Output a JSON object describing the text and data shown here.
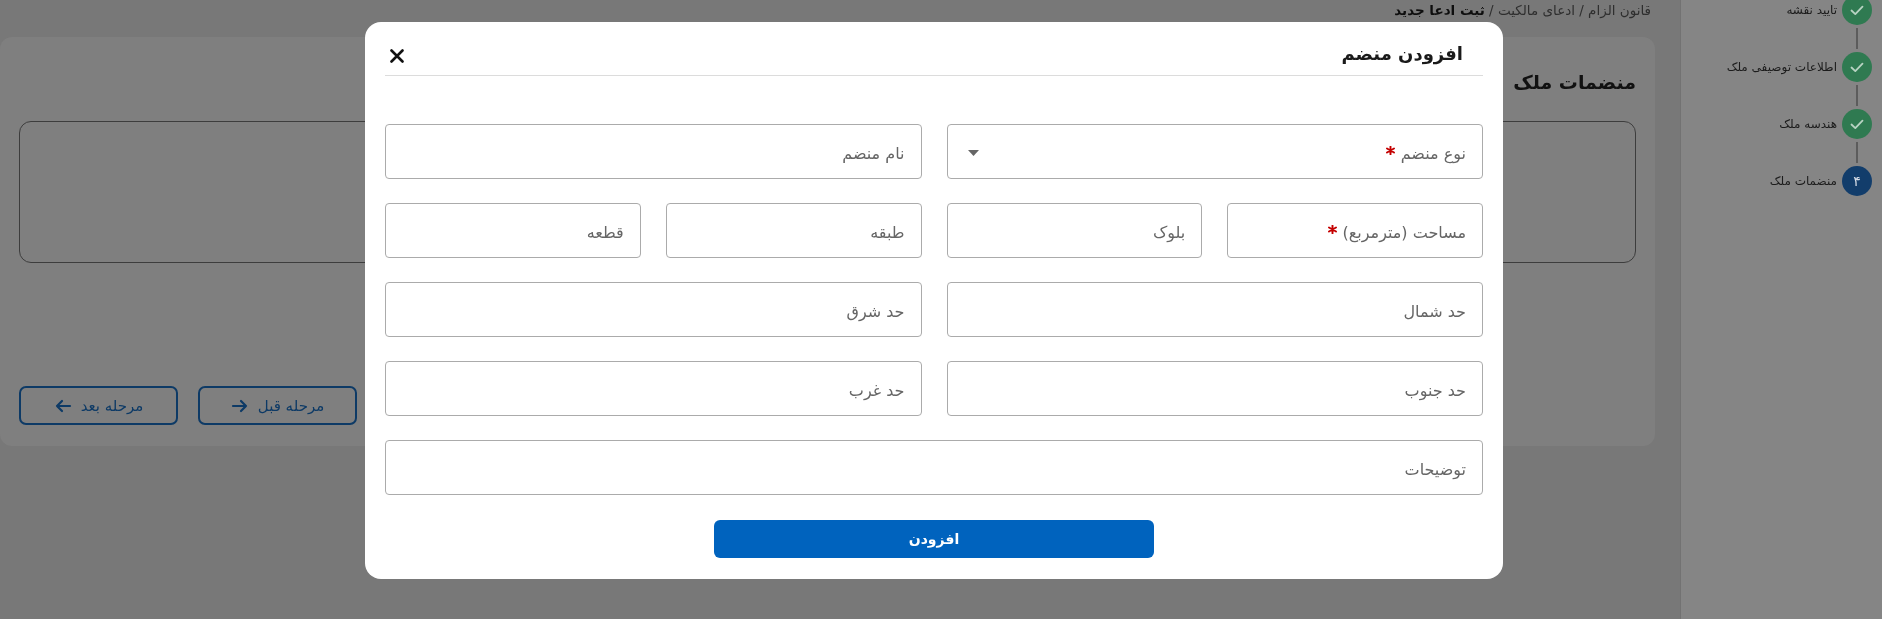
{
  "sidebar": {
    "steps": [
      {
        "label": "تایید نقشه",
        "completed": true,
        "selected": false
      },
      {
        "label": "اطلاعات توصیفی ملک",
        "completed": true,
        "selected": false
      },
      {
        "label": "هندسه ملک",
        "completed": true,
        "selected": false
      },
      {
        "label": "منضمات ملک",
        "completed": false,
        "selected": true,
        "number": "۴"
      }
    ]
  },
  "breadcrumb": {
    "text": "قانون الزام / ادعای مالکیت / **ثبت ادعا جدید**"
  },
  "page": {
    "title": "منضمات ملک",
    "buttons": [
      {
        "label": "مرحله قبل",
        "kind": "previous"
      },
      {
        "label": "مرحله بعد",
        "kind": "next"
      }
    ]
  },
  "modal": {
    "title": "افزودن منضم",
    "rows": [
      [
        {
          "kind": "select",
          "placeholder": "نوع منضم",
          "required": true
        },
        {
          "kind": "text",
          "placeholder": "نام منضم",
          "required": false
        }
      ],
      [
        {
          "kind": "text",
          "placeholder": "مساحت (مترمربع)",
          "required": true
        },
        {
          "kind": "text",
          "placeholder": "بلوک",
          "required": false
        },
        {
          "kind": "text",
          "placeholder": "طبقه",
          "required": false
        },
        {
          "kind": "text",
          "placeholder": "قطعه",
          "required": false
        }
      ],
      [
        {
          "kind": "text",
          "placeholder": "حد شمال",
          "required": false
        },
        {
          "kind": "text",
          "placeholder": "حد شرق",
          "required": false
        }
      ],
      [
        {
          "kind": "text",
          "placeholder": "حد جنوب",
          "required": false
        },
        {
          "kind": "text",
          "placeholder": "حد غرب",
          "required": false
        }
      ],
      [
        {
          "kind": "text",
          "placeholder": "توضیحات",
          "required": false
        }
      ]
    ],
    "submit": "افزودن"
  }
}
